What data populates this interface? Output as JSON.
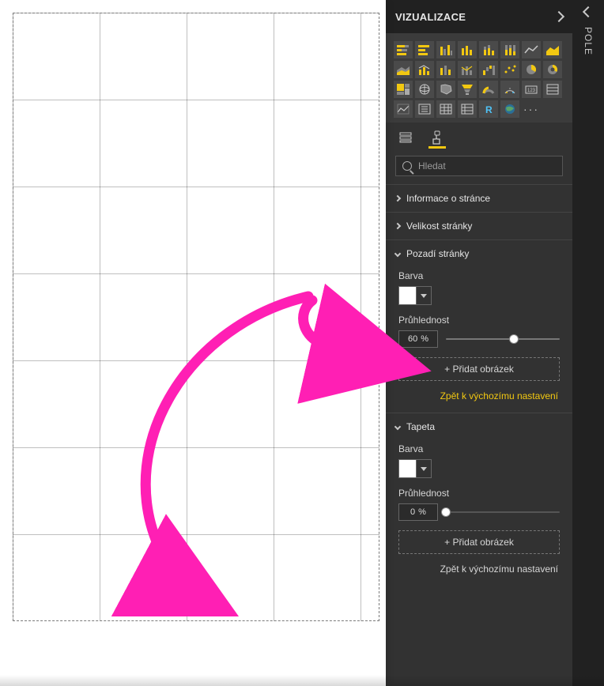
{
  "viz": {
    "title": "VIZUALIZACE",
    "search_placeholder": "Hledat",
    "sections": {
      "info": {
        "label": "Informace o stránce"
      },
      "size": {
        "label": "Velikost stránky"
      },
      "background": {
        "label": "Pozadí stránky",
        "color_label": "Barva",
        "transparency_label": "Průhlednost",
        "transparency_value": "60",
        "transparency_unit": "%",
        "add_image": "+ Přidat obrázek",
        "reset": "Zpět k výchozímu nastavení"
      },
      "wallpaper": {
        "label": "Tapeta",
        "color_label": "Barva",
        "transparency_label": "Průhlednost",
        "transparency_value": "0",
        "transparency_unit": "%",
        "add_image": "+ Přidat obrázek",
        "reset": "Zpět k výchozímu nastavení"
      }
    }
  },
  "pole": {
    "title": "POLE"
  },
  "gallery_icons": [
    "stacked-bar",
    "bar",
    "clustered-column",
    "column",
    "stacked-column",
    "100-column",
    "line",
    "area",
    "stacked-area",
    "line-column",
    "ribbon",
    "line-column2",
    "waterfall",
    "scatter",
    "pie",
    "donut",
    "treemap",
    "map",
    "filled-map",
    "funnel",
    "gauge",
    "kpi",
    "card",
    "multi-card",
    "kpi2",
    "slicer",
    "table",
    "matrix",
    "r",
    "arcgis",
    "more"
  ]
}
